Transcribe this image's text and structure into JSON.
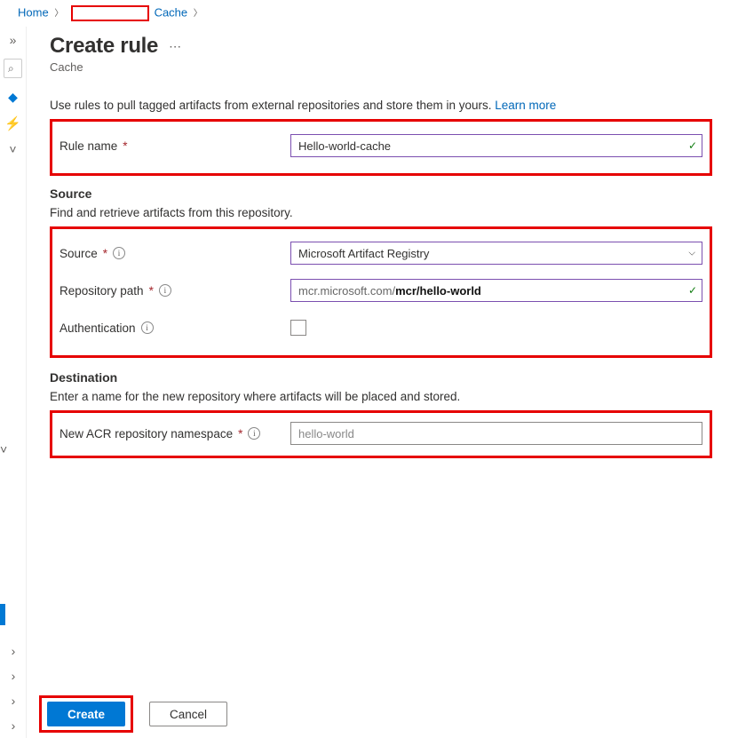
{
  "breadcrumb": {
    "home": "Home",
    "cache": "Cache"
  },
  "header": {
    "title": "Create rule",
    "subtitle": "Cache"
  },
  "intro": {
    "text": "Use rules to pull tagged artifacts from external repositories and store them in yours. ",
    "learn_more": "Learn more"
  },
  "fields": {
    "rule_name_label": "Rule name",
    "rule_name_value": "Hello-world-cache"
  },
  "source": {
    "heading": "Source",
    "subtext": "Find and retrieve artifacts from this repository.",
    "source_label": "Source",
    "source_value": "Microsoft Artifact Registry",
    "repo_label": "Repository path",
    "repo_prefix": "mcr.microsoft.com/",
    "repo_suffix": "mcr/hello-world",
    "auth_label": "Authentication"
  },
  "destination": {
    "heading": "Destination",
    "subtext": "Enter a name for the new repository where artifacts will be placed and stored.",
    "ns_label": "New ACR repository namespace",
    "ns_value": "hello-world"
  },
  "footer": {
    "create": "Create",
    "cancel": "Cancel"
  }
}
